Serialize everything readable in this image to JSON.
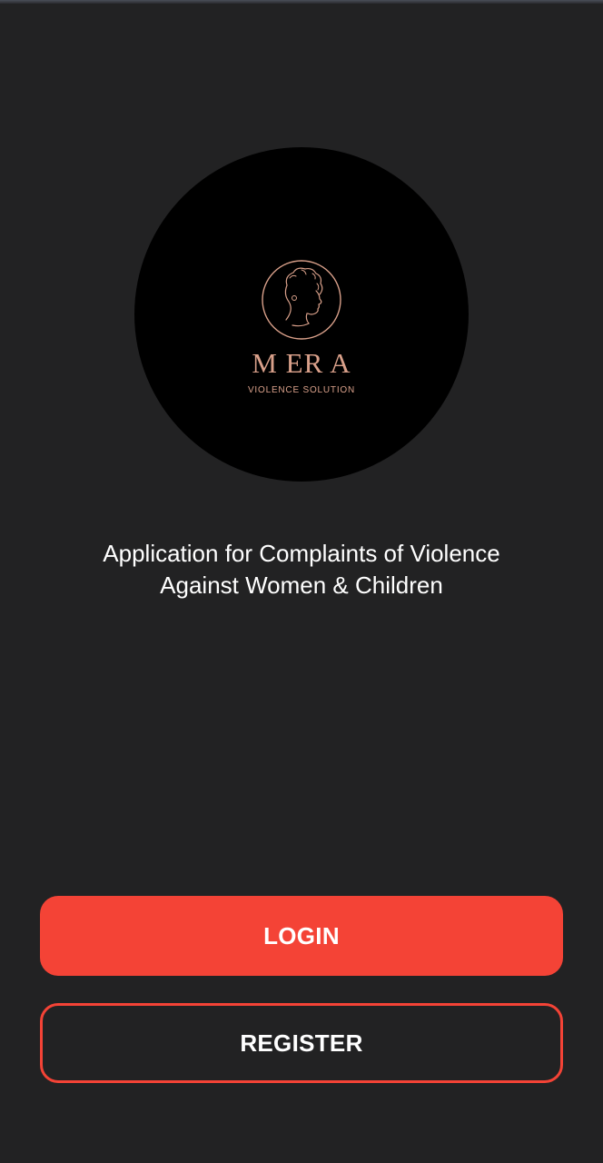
{
  "logo": {
    "name": "M ER A",
    "tagline": "VIOLENCE SOLUTION",
    "emblem_icon": "woman-profile-icon"
  },
  "description": {
    "line1": "Application for Complaints of Violence",
    "line2": "Against Women & Children"
  },
  "buttons": {
    "login_label": "LOGIN",
    "register_label": "REGISTER"
  },
  "colors": {
    "background": "#222223",
    "accent": "#f44336",
    "logo_gold": "#d9a08a",
    "logo_circle": "#000000"
  }
}
